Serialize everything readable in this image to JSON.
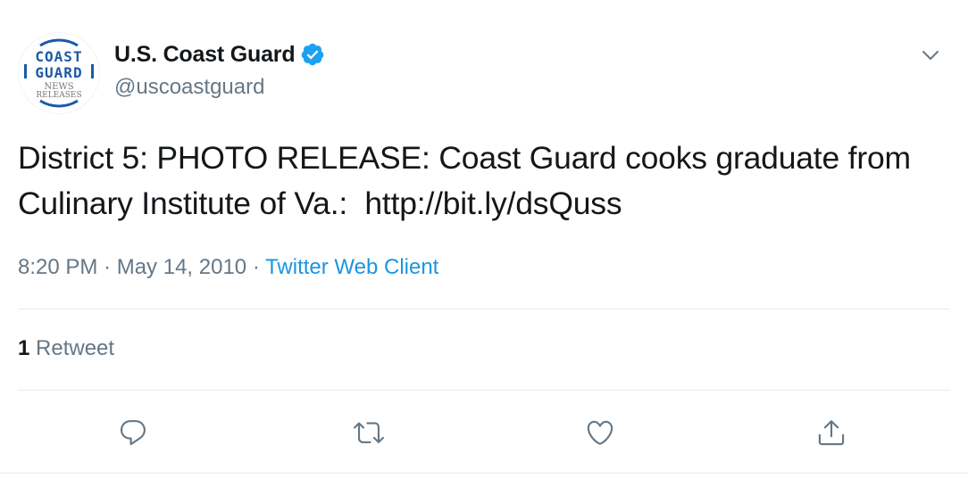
{
  "user": {
    "display_name": "U.S. Coast Guard",
    "handle": "@uscoastguard",
    "verified": true,
    "avatar": {
      "line1": "COAST",
      "line2": "GUARD",
      "line3": "NEWS",
      "line4": "RELEASES"
    }
  },
  "tweet": {
    "text": "District 5: PHOTO RELEASE: Coast Guard cooks graduate from Culinary Institute of Va.:  http://bit.ly/dsQuss",
    "time": "8:20 PM",
    "separator": " · ",
    "date": "May 14, 2010",
    "source": "Twitter Web Client"
  },
  "stats": {
    "retweet_count": "1",
    "retweet_label": "Retweet"
  },
  "icons": {
    "verified": "verified-badge-icon",
    "menu": "chevron-down-icon",
    "reply": "reply-icon",
    "retweet": "retweet-icon",
    "like": "heart-icon",
    "share": "share-icon"
  },
  "colors": {
    "text_primary": "#14171a",
    "text_secondary": "#657786",
    "link": "#1b95e0",
    "verified_blue": "#1da1f2",
    "divider": "#e6ecf0",
    "avatar_blue": "#1a5aa8"
  }
}
